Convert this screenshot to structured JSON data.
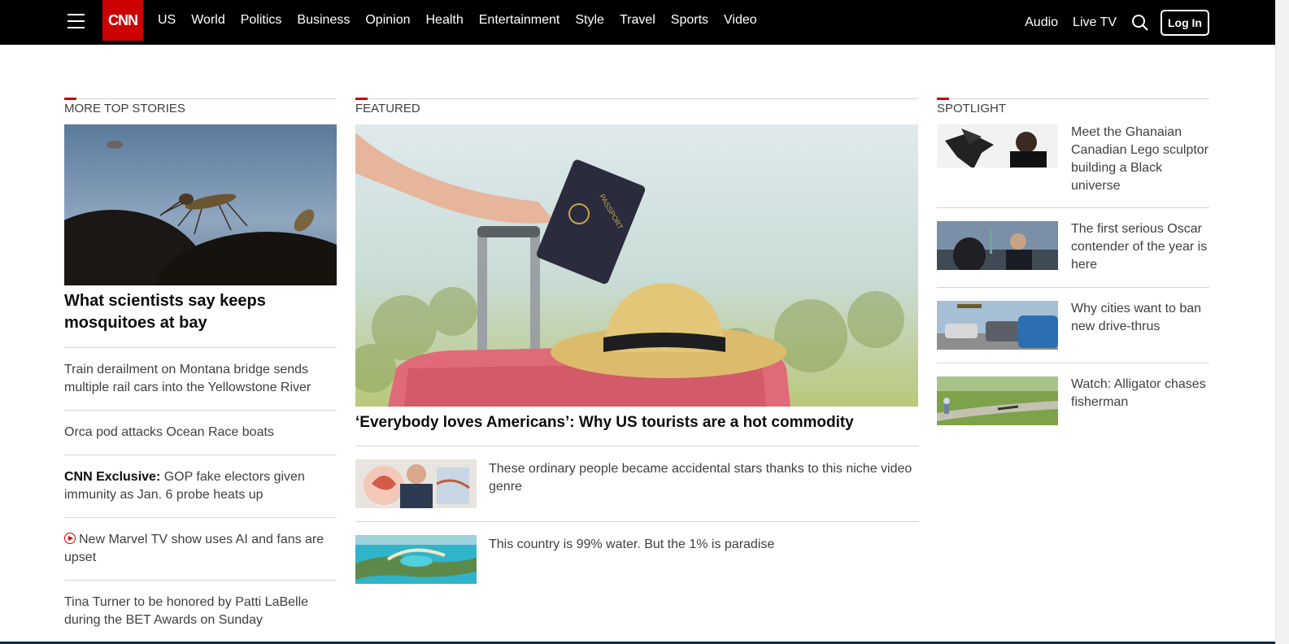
{
  "nav": {
    "logo": "CNN",
    "links": [
      "US",
      "World",
      "Politics",
      "Business",
      "Opinion",
      "Health",
      "Entertainment",
      "Style",
      "Travel",
      "Sports",
      "Video"
    ],
    "right_links": [
      "Audio",
      "Live TV"
    ],
    "login": "Log In"
  },
  "left": {
    "label": "MORE TOP STORIES",
    "lead_title": "What scientists say keeps mosquitoes at bay",
    "items": [
      {
        "text": "Train derailment on Montana bridge sends multiple rail cars into the Yellowstone River"
      },
      {
        "text": "Orca pod attacks Ocean Race boats"
      },
      {
        "prefix": "CNN Exclusive:",
        "text": " GOP fake electors given immunity as Jan. 6 probe heats up"
      },
      {
        "text": "New Marvel TV show uses AI and fans are upset"
      },
      {
        "text": "Tina Turner to be honored by Patti LaBelle during the BET Awards on Sunday"
      }
    ]
  },
  "middle": {
    "label": "FEATURED",
    "feat_title": "‘Everybody loves Americans’: Why US tourists are a hot commodity",
    "passport_text": "PASSPORT",
    "rows": [
      {
        "text": "These ordinary people became accidental stars thanks to this niche video genre"
      },
      {
        "text": "This country is 99% water. But the 1% is paradise"
      }
    ]
  },
  "right": {
    "label": "SPOTLIGHT",
    "items": [
      {
        "text": "Meet the Ghanaian Canadian Lego sculptor building a Black universe"
      },
      {
        "text": "The first serious Oscar contender of the year is here"
      },
      {
        "text": "Why cities want to ban new drive-thrus"
      },
      {
        "text": "Watch: Alligator chases fisherman"
      }
    ]
  }
}
